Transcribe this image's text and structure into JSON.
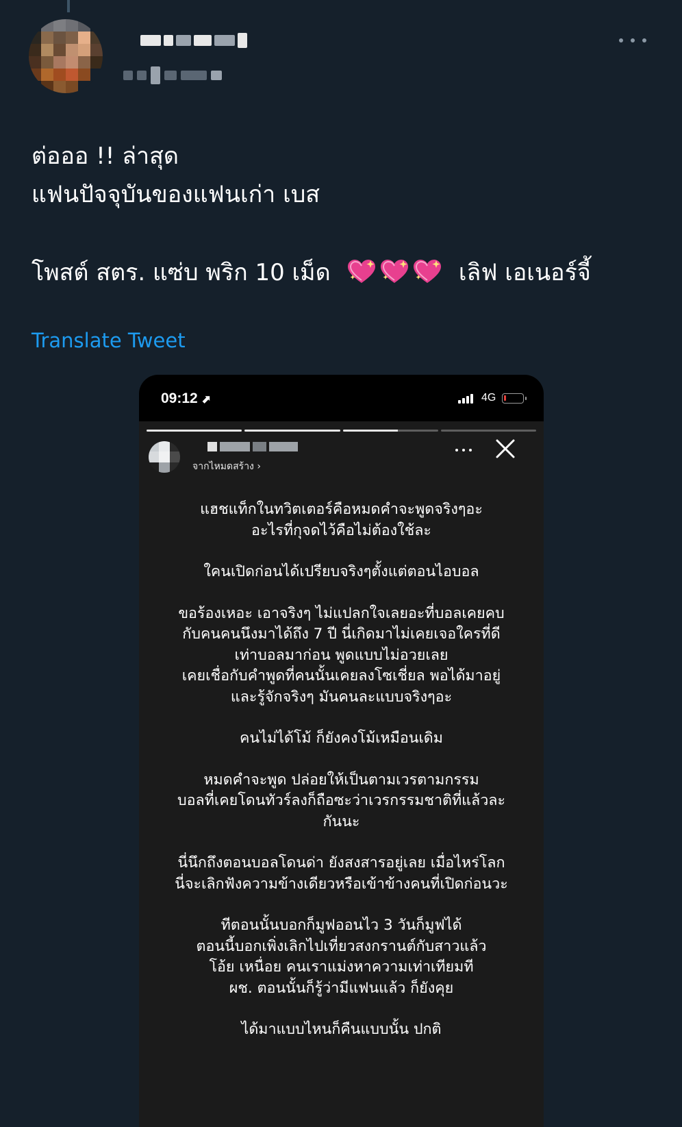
{
  "tweet": {
    "lines": [
      "ต่อออ !! ล่าสุด",
      "แฟนปัจจุบันของแฟนเก่า เบส",
      "โพสต์ สตร. แซ่บ พริก 10 เม็ด",
      "เลิฟ เอเนอร์จี้"
    ],
    "emoji": "sparkling-heart-icon",
    "emoji_count": 3,
    "translate_label": "Translate Tweet"
  },
  "phone": {
    "status": {
      "time": "09:12",
      "network": "4G",
      "battery_level": 0.12,
      "battery_color": "#e5413b"
    },
    "story_progress": [
      1,
      1,
      0.58,
      0
    ],
    "story_sub": "จากไหมดสร้าง ›",
    "paragraphs": [
      [
        "แฮชแท็กในทวิตเตอร์คือหมดคำจะพูดจริงๆอะ",
        "อะไรที่กุจดไว้คือไม่ต้องใช้ละ"
      ],
      [
        "ใคนเปิดก่อนได้เปรียบจริงๆตั้งแต่ตอนไอบอล"
      ],
      [
        "ขอร้องเหอะ เอาจริงๆ ไม่แปลกใจเลยอะที่บอลเคยคบ",
        "กับคนคนนึงมาได้ถึง 7 ปี นี่เกิดมาไม่เคยเจอใครที่ดี",
        "เท่าบอลมาก่อน พูดแบบไม่อวยเลย",
        "เคยเชื่อกับคำพูดที่คนนั้นเคยลงโซเชี่ยล พอได้มาอยู่",
        "และรู้จักจริงๆ มันคนละแบบจริงๆอะ"
      ],
      [
        "คนไม่ได้โม้ ก็ยังคงโม้เหมือนเดิม"
      ],
      [
        "หมดคำจะพูด ปล่อยให้เป็นตามเวรตามกรรม",
        "บอลที่เคยโดนทัวร์ลงก็ถือซะว่าเวรกรรมชาติที่แล้วละ",
        "กันนะ"
      ],
      [
        "นี่นึกถึงตอนบอลโดนด่า ยังสงสารอยู่เลย เมื่อไหร่โลก",
        "นี่จะเลิกฟังความข้างเดียวหรือเข้าข้างคนที่เปิดก่อนวะ"
      ],
      [
        "ทีตอนนั้นบอกก็มูฟออนไว  3 วันก็มูฟได้",
        "ตอนนี้บอกเพิ่งเลิกไปเที่ยวสงกรานต์กับสาวแล้ว",
        "โอ้ย เหนื่อย คนเราแม่งหาความเท่าเทียมที",
        "ผช. ตอนนั้นก็รู้ว่ามีแฟนแล้ว ก็ยังคุย"
      ],
      [
        "ได้มาแบบไหนก็คืนแบบนั้น ปกติ"
      ]
    ]
  }
}
